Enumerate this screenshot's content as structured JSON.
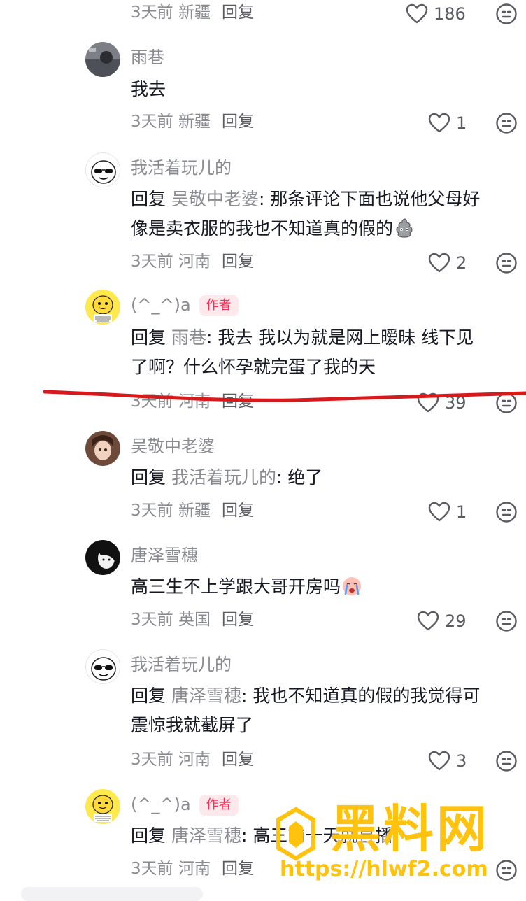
{
  "comments": [
    {
      "meta": {
        "time": "3天前",
        "location": "新疆",
        "reply": "回复"
      },
      "likes": "186"
    },
    {
      "username": "雨巷",
      "text": "我去",
      "meta": {
        "time": "3天前",
        "location": "新疆",
        "reply": "回复"
      },
      "likes": "1"
    },
    {
      "username": "我活着玩儿的",
      "reply_prefix": "回复",
      "reply_to": "吴敬中老婆",
      "text_line1": ": 那条评论下面也说他父母好",
      "text_line2": "像是卖衣服的我也不知道真的假的",
      "meta": {
        "time": "3天前",
        "location": "河南",
        "reply": "回复"
      },
      "likes": "2"
    },
    {
      "username": "(^_^)a",
      "badge": "作者",
      "reply_prefix": "回复",
      "reply_to": "雨巷",
      "text_line1": ": 我去 我以为就是网上暧昧 线下见",
      "text_line2": "了啊？什么怀孕就完蛋了我的天",
      "meta": {
        "time": "3天前",
        "location": "河南",
        "reply": "回复"
      },
      "likes": "39"
    },
    {
      "username": "吴敬中老婆",
      "reply_prefix": "回复",
      "reply_to": "我活着玩儿的",
      "text_line1": ": 绝了",
      "meta": {
        "time": "3天前",
        "location": "新疆",
        "reply": "回复"
      },
      "likes": "1"
    },
    {
      "username": "唐泽雪穗",
      "text": "高三生不上学跟大哥开房吗",
      "meta": {
        "time": "3天前",
        "location": "英国",
        "reply": "回复"
      },
      "likes": "29"
    },
    {
      "username": "我活着玩儿的",
      "reply_prefix": "回复",
      "reply_to": "唐泽雪穗",
      "text_line1": ": 我也不知道真的假的我觉得可",
      "text_line2": "震惊我就截屏了",
      "meta": {
        "time": "3天前",
        "location": "河南",
        "reply": "回复"
      },
      "likes": "3"
    },
    {
      "username": "(^_^)a",
      "badge": "作者",
      "reply_prefix": "回复",
      "reply_to": "唐泽雪穗",
      "text_line1": ": 高三前一天就直播",
      "meta": {
        "time": "3天前",
        "location": "河南",
        "reply": "回复"
      }
    }
  ],
  "watermark": {
    "title": "黑料网",
    "url": "https://hlwf2.com"
  },
  "colors": {
    "accent": "#fe2c55",
    "annotation_line": "#d7191c",
    "watermark": "#ffc20e"
  }
}
